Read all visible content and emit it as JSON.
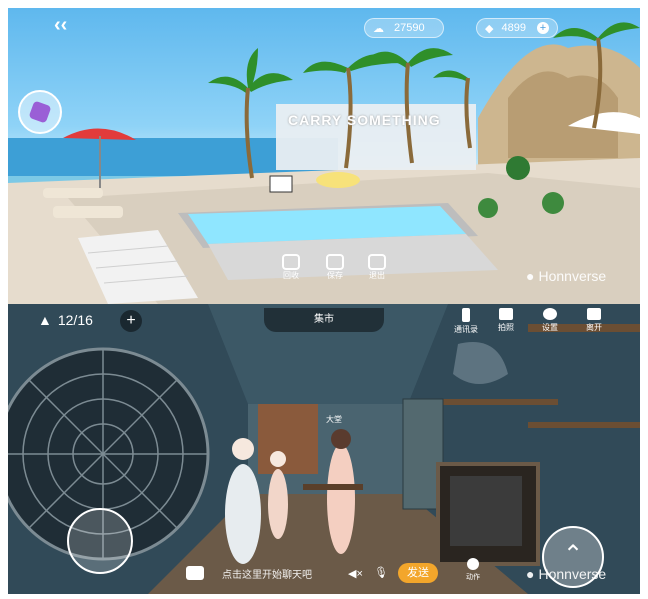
{
  "top_screen": {
    "coins": "27590",
    "gems": "4899",
    "sign_text": "CARRY SOMETHING",
    "tools": [
      {
        "label": "回收"
      },
      {
        "label": "保存"
      },
      {
        "label": "退出"
      }
    ],
    "watermark": "Honnverse"
  },
  "bottom_screen": {
    "players": "12/16",
    "room_title": "集市",
    "top_buttons": [
      {
        "label": "通讯录",
        "icon": "phone-icon"
      },
      {
        "label": "拍照",
        "icon": "camera-icon"
      },
      {
        "label": "设置",
        "icon": "gear-icon"
      },
      {
        "label": "离开",
        "icon": "exit-icon"
      }
    ],
    "npc_tag": "大堂",
    "chat_placeholder": "点击这里开始聊天吧",
    "send_label": "发送",
    "action_label": "动作",
    "watermark": "Honnverse",
    "accent_color": "#f3a62b"
  }
}
